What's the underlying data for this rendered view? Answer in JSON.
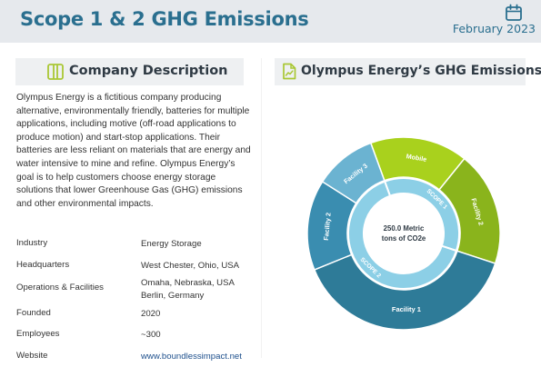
{
  "header": {
    "title": "Scope 1 & 2 GHG Emissions",
    "date": "February 2023",
    "calendar_icon": "calendar-icon"
  },
  "company_section": {
    "heading": "Company Description",
    "icon": "building-icon",
    "description": "Olympus Energy is a fictitious company producing alternative, environmentally friendly, batteries for multiple applications, including motive (off-road applications to produce motion) and start-stop applications. Their batteries are less reliant on materials that are energy and water intensive to mine and refine. Olympus Energy’s goal is to help customers choose energy storage solutions that lower Greenhouse Gas (GHG) emissions and other environmental impacts.",
    "details": [
      {
        "key": "Industry",
        "value": "Energy Storage"
      },
      {
        "key": "Headquarters",
        "value": "West Chester, Ohio, USA"
      },
      {
        "key": "Operations & Facilities",
        "value": "Omaha, Nebraska, USA\nBerlin, Germany"
      },
      {
        "key": "Founded",
        "value": "2020"
      },
      {
        "key": "Employees",
        "value": "~300"
      },
      {
        "key": "Website",
        "value": "www.boundlessimpact.net"
      }
    ]
  },
  "emissions_section": {
    "heading": "Olympus Energy’s GHG Emissions",
    "icon": "chart-file-icon"
  },
  "chart_data": {
    "type": "sunburst",
    "title": "Olympus Energy’s GHG Emissions",
    "center_label": [
      "250.0 Metric",
      "tons of CO2e"
    ],
    "total": 250.0,
    "inner": [
      {
        "name": "SCOPE 1",
        "value": 89,
        "color": "#8ccfe6"
      },
      {
        "name": "SCOPE 2",
        "value": 161,
        "color": "#8ccfe6"
      }
    ],
    "outer": [
      {
        "name": "Mobile",
        "parent": "SCOPE 1",
        "value": 41,
        "color": "#a9d11d"
      },
      {
        "name": "Facility 2",
        "parent": "SCOPE 1",
        "value": 48,
        "color": "#8ab41c"
      },
      {
        "name": "Facility 1",
        "parent": "SCOPE 2",
        "value": 97,
        "color": "#2e7b98"
      },
      {
        "name": "Facility 2",
        "parent": "SCOPE 2",
        "value": 38,
        "color": "#3a8db0"
      },
      {
        "name": "Facility 3",
        "parent": "SCOPE 2",
        "value": 26,
        "color": "#6bb3d1"
      }
    ]
  }
}
